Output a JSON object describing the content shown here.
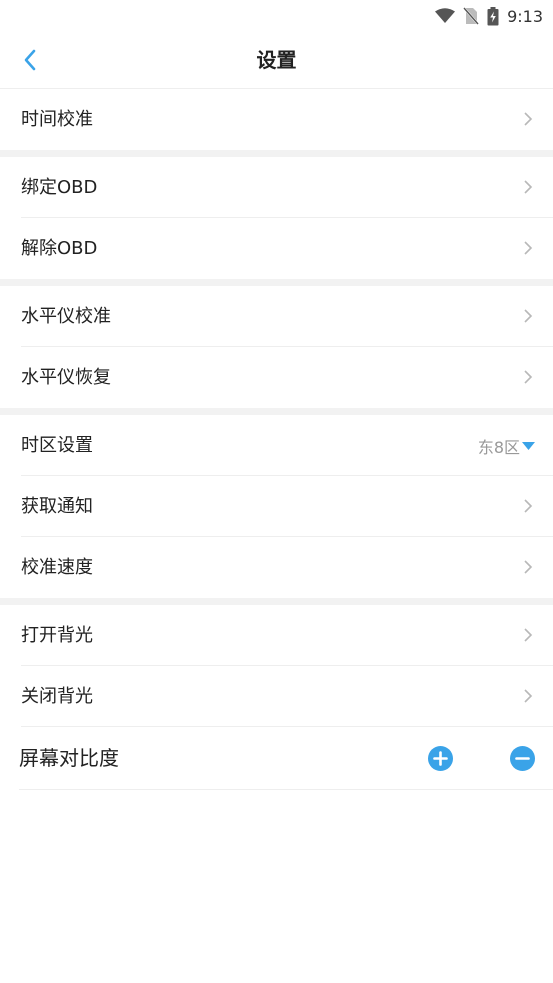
{
  "status_bar": {
    "time": "9:13",
    "icons": [
      "wifi-icon",
      "no-sim-icon",
      "battery-charging-icon"
    ]
  },
  "nav": {
    "title": "设置",
    "back_icon": "back-arrow-icon"
  },
  "groups": [
    [
      {
        "id": "time-calibration",
        "label": "时间校准"
      }
    ],
    [
      {
        "id": "bind-obd",
        "label": "绑定OBD"
      },
      {
        "id": "unbind-obd",
        "label": "解除OBD"
      }
    ],
    [
      {
        "id": "level-calibration",
        "label": "水平仪校准"
      },
      {
        "id": "level-restore",
        "label": "水平仪恢复"
      }
    ],
    [
      {
        "id": "timezone",
        "label": "时区设置",
        "value": "东8区"
      },
      {
        "id": "get-notification",
        "label": "获取通知"
      },
      {
        "id": "speed-calibration",
        "label": "校准速度"
      }
    ],
    [
      {
        "id": "backlight-on",
        "label": "打开背光"
      },
      {
        "id": "backlight-off",
        "label": "关闭背光"
      }
    ]
  ],
  "contrast": {
    "label": "屏幕对比度",
    "increase_icon": "plus-circle-icon",
    "decrease_icon": "minus-circle-icon"
  },
  "colors": {
    "accent": "#3aa3e8",
    "separator": "#f2f2f2",
    "chevron": "#b8b8b8",
    "secondary_text": "#999999"
  }
}
